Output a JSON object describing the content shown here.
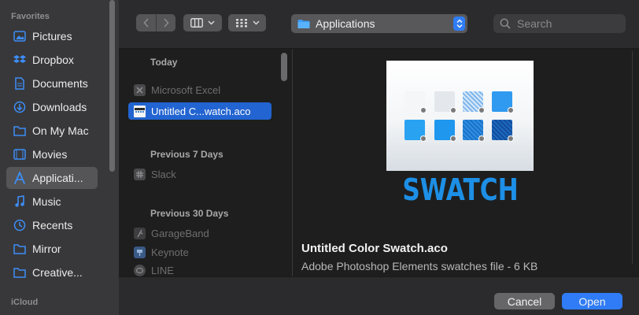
{
  "sidebar": {
    "favorites_label": "Favorites",
    "icloud_label": "iCloud",
    "items": [
      {
        "label": "Pictures",
        "icon": "pictures-icon"
      },
      {
        "label": "Dropbox",
        "icon": "dropbox-icon"
      },
      {
        "label": "Documents",
        "icon": "documents-icon"
      },
      {
        "label": "Downloads",
        "icon": "downloads-icon"
      },
      {
        "label": "On My Mac",
        "icon": "folder-icon"
      },
      {
        "label": "Movies",
        "icon": "movies-icon"
      },
      {
        "label": "Applicati...",
        "icon": "applications-icon",
        "selected": true
      },
      {
        "label": "Music",
        "icon": "music-icon"
      },
      {
        "label": "Recents",
        "icon": "recents-icon"
      },
      {
        "label": "Mirror",
        "icon": "folder-icon"
      },
      {
        "label": "Creative...",
        "icon": "folder-icon"
      }
    ]
  },
  "toolbar": {
    "location": "Applications",
    "search_placeholder": "Search"
  },
  "list": {
    "groups": [
      {
        "header": "Today",
        "items": [
          {
            "label": "Microsoft Excel",
            "icon": "excel-app-icon"
          },
          {
            "label": "Untitled C...watch.aco",
            "icon": "aco-file-icon",
            "selected": true
          }
        ]
      },
      {
        "header": "Previous 7 Days",
        "items": [
          {
            "label": "Slack",
            "icon": "slack-app-icon"
          }
        ]
      },
      {
        "header": "Previous 30 Days",
        "items": [
          {
            "label": "GarageBand",
            "icon": "garageband-app-icon"
          },
          {
            "label": "Keynote",
            "icon": "keynote-app-icon"
          },
          {
            "label": "LINE",
            "icon": "line-app-icon"
          }
        ]
      }
    ]
  },
  "preview": {
    "thumbnail_text": "SWATCH",
    "file_name": "Untitled Color Swatch.aco",
    "file_info": "Adobe Photoshop Elements swatches file - 6 KB"
  },
  "buttons": {
    "cancel": "Cancel",
    "open": "Open"
  },
  "colors": {
    "accent": "#2f7cf6",
    "selection": "#2264d1",
    "swatch_blue": "#1d8fe6"
  }
}
